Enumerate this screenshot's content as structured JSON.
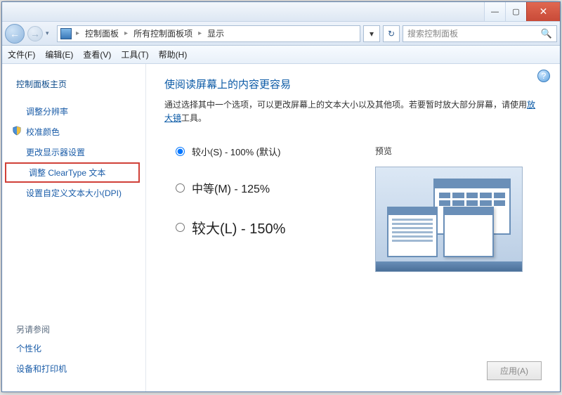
{
  "titlebar": {
    "min": "—",
    "max": "▢",
    "close": "✕"
  },
  "nav": {
    "back": "←",
    "fwd": "→",
    "dd": "▾"
  },
  "address": {
    "crumb1": "控制面板",
    "crumb2": "所有控制面板项",
    "crumb3": "显示",
    "chev": "▸",
    "dd": "▾",
    "refresh": "↻"
  },
  "search": {
    "placeholder": "搜索控制面板",
    "mag": "🔍"
  },
  "menu": {
    "file": "文件(F)",
    "edit": "编辑(E)",
    "view": "查看(V)",
    "tools": "工具(T)",
    "help": "帮助(H)"
  },
  "sidebar": {
    "home": "控制面板主页",
    "resolution": "调整分辨率",
    "calibrate": "校准颜色",
    "display_settings": "更改显示器设置",
    "cleartype": "调整 ClearType 文本",
    "dpi": "设置自定义文本大小(DPI)",
    "see_also": "另请参阅",
    "personalize": "个性化",
    "devices": "设备和打印机"
  },
  "content": {
    "heading": "使阅读屏幕上的内容更容易",
    "desc_pre": "通过选择其中一个选项，可以更改屏幕上的文本大小以及其他项。若要暂时放大部分屏幕，请使用",
    "magnifier_link": "放大镜",
    "desc_post": "工具。",
    "opt_small": "较小(S) - 100% (默认)",
    "opt_med": "中等(M) - 125%",
    "opt_large": "较大(L) - 150%",
    "preview": "预览",
    "apply": "应用(A)",
    "help": "?"
  }
}
